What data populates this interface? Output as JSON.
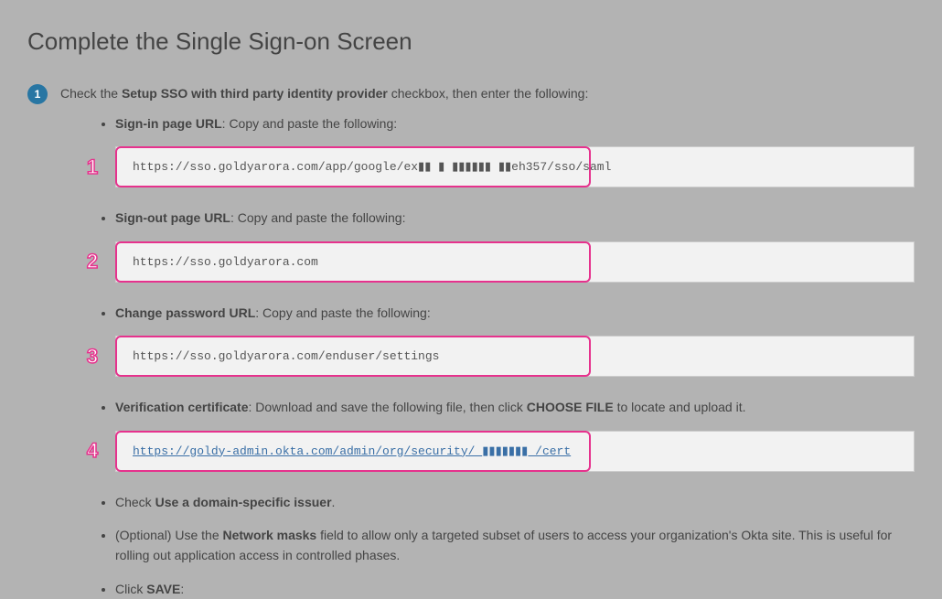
{
  "title": "Complete the Single Sign-on Screen",
  "step": {
    "number": "1",
    "prefix": "Check the ",
    "bold": "Setup SSO with third party identity provider",
    "suffix": " checkbox, then enter the following:"
  },
  "items": [
    {
      "label_bold": "Sign-in page URL",
      "label_rest": ": Copy and paste the following:",
      "annotation": "1",
      "code": "https://sso.goldyarora.com/app/google/ex▮▮ ▮ ▮▮▮▮▮▮ ▮▮eh357/sso/saml",
      "link": false
    },
    {
      "label_bold": "Sign-out page URL",
      "label_rest": ": Copy and paste the following:",
      "annotation": "2",
      "code": "https://sso.goldyarora.com",
      "link": false
    },
    {
      "label_bold": "Change password URL",
      "label_rest": ": Copy and paste the following:",
      "annotation": "3",
      "code": "https://sso.goldyarora.com/enduser/settings",
      "link": false
    },
    {
      "label_bold": "Verification certificate",
      "label_rest_prefix": ": Download and save the following file, then click ",
      "label_rest_bold": "CHOOSE FILE",
      "label_rest_suffix": " to locate and upload it.",
      "annotation": "4",
      "code": "https://goldy-admin.okta.com/admin/org/security/_▮▮▮▮▮▮▮_/cert",
      "link": true
    }
  ],
  "trailing": [
    {
      "prefix": "Check ",
      "bold": "Use a domain-specific issuer",
      "suffix": "."
    },
    {
      "prefix": "(Optional) Use the ",
      "bold": "Network masks",
      "suffix": " field to allow only a targeted subset of users to access your organization's Okta site. This is useful for rolling out application access in controlled phases."
    },
    {
      "prefix": "Click ",
      "bold": "SAVE",
      "suffix": ":"
    }
  ]
}
